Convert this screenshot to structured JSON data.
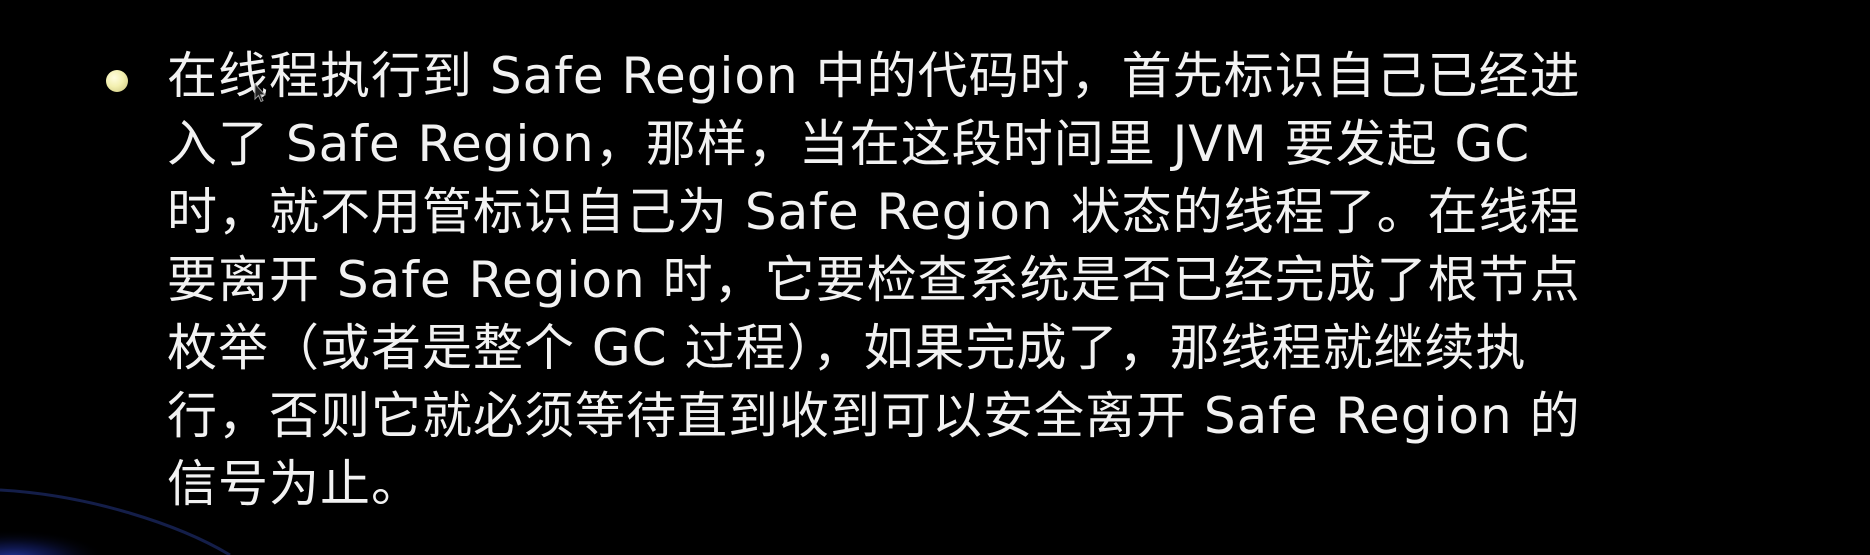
{
  "slide": {
    "bullet_text": "在线程执行到 Safe Region 中的代码时，首先标识自己已经进入了 Safe Region，那样，当在这段时间里 JVM 要发起 GC 时，就不用管标识自己为 Safe Region 状态的线程了。在线程要离开 Safe Region 时，它要检查系统是否已经完成了根节点枚举（或者是整个 GC 过程），如果完成了，那线程就继续执行，否则它就必须等待直到收到可以安全离开 Safe Region 的信号为止。"
  },
  "colors": {
    "background": "#000000",
    "text": "#f2f2f2",
    "bullet": "#f3f0b0",
    "swoosh": "#1a2a8a"
  },
  "icons": {
    "bullet": "round-bullet-icon",
    "cursor": "mouse-cursor-icon"
  }
}
